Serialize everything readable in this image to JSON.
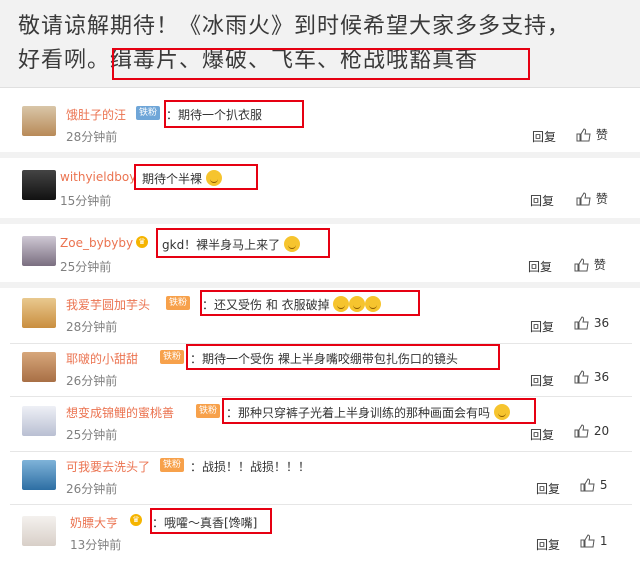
{
  "header": {
    "line1": "敬请谅解期待！《冰雨火》到时候希望大家多多支持，",
    "line2_prefix": "好看咧。",
    "line2_highlight": "缉毒片、爆破、飞车、枪战哦豁真香"
  },
  "labels": {
    "reply": "回复",
    "like": "赞"
  },
  "comments": [
    {
      "user": "饿肚子的汪",
      "badge": "铁粉",
      "text": "：期待一个扒衣服",
      "time": "28分钟前",
      "likes": ""
    },
    {
      "user": "withyieldboy",
      "badge": "",
      "text": "期待个半裸",
      "time": "15分钟前",
      "likes": ""
    },
    {
      "user": "Zoe_bybyby",
      "badge": "",
      "text": "gkd！裸半身马上来了",
      "time": "25分钟前",
      "likes": ""
    },
    {
      "user": "我爱芋圆加芋头",
      "badge": "铁粉",
      "text": "：还又受伤 和 衣服破掉",
      "time": "28分钟前",
      "likes": "36"
    },
    {
      "user": "耶啵的小甜甜",
      "badge": "铁粉",
      "text": "：期待一个受伤 裸上半身嘴咬绷带包扎伤口的镜头",
      "time": "26分钟前",
      "likes": "36"
    },
    {
      "user": "想变成锦鲤的蜜桃善",
      "badge": "铁粉",
      "text": "：那种只穿裤子光着上半身训练的那种画面会有吗",
      "time": "25分钟前",
      "likes": "20"
    },
    {
      "user": "可我要去洗头了",
      "badge": "铁粉",
      "text": "：战损！！战损！！！",
      "time": "26分钟前",
      "likes": "5"
    },
    {
      "user": "奶膘大亨",
      "badge": "",
      "text": "：哦嚯～真香[馋嘴]",
      "time": "13分钟前",
      "likes": "1"
    }
  ],
  "colors": {
    "highlight": "#e60012",
    "username": "#eb7350",
    "badge": "#f7a14b"
  }
}
